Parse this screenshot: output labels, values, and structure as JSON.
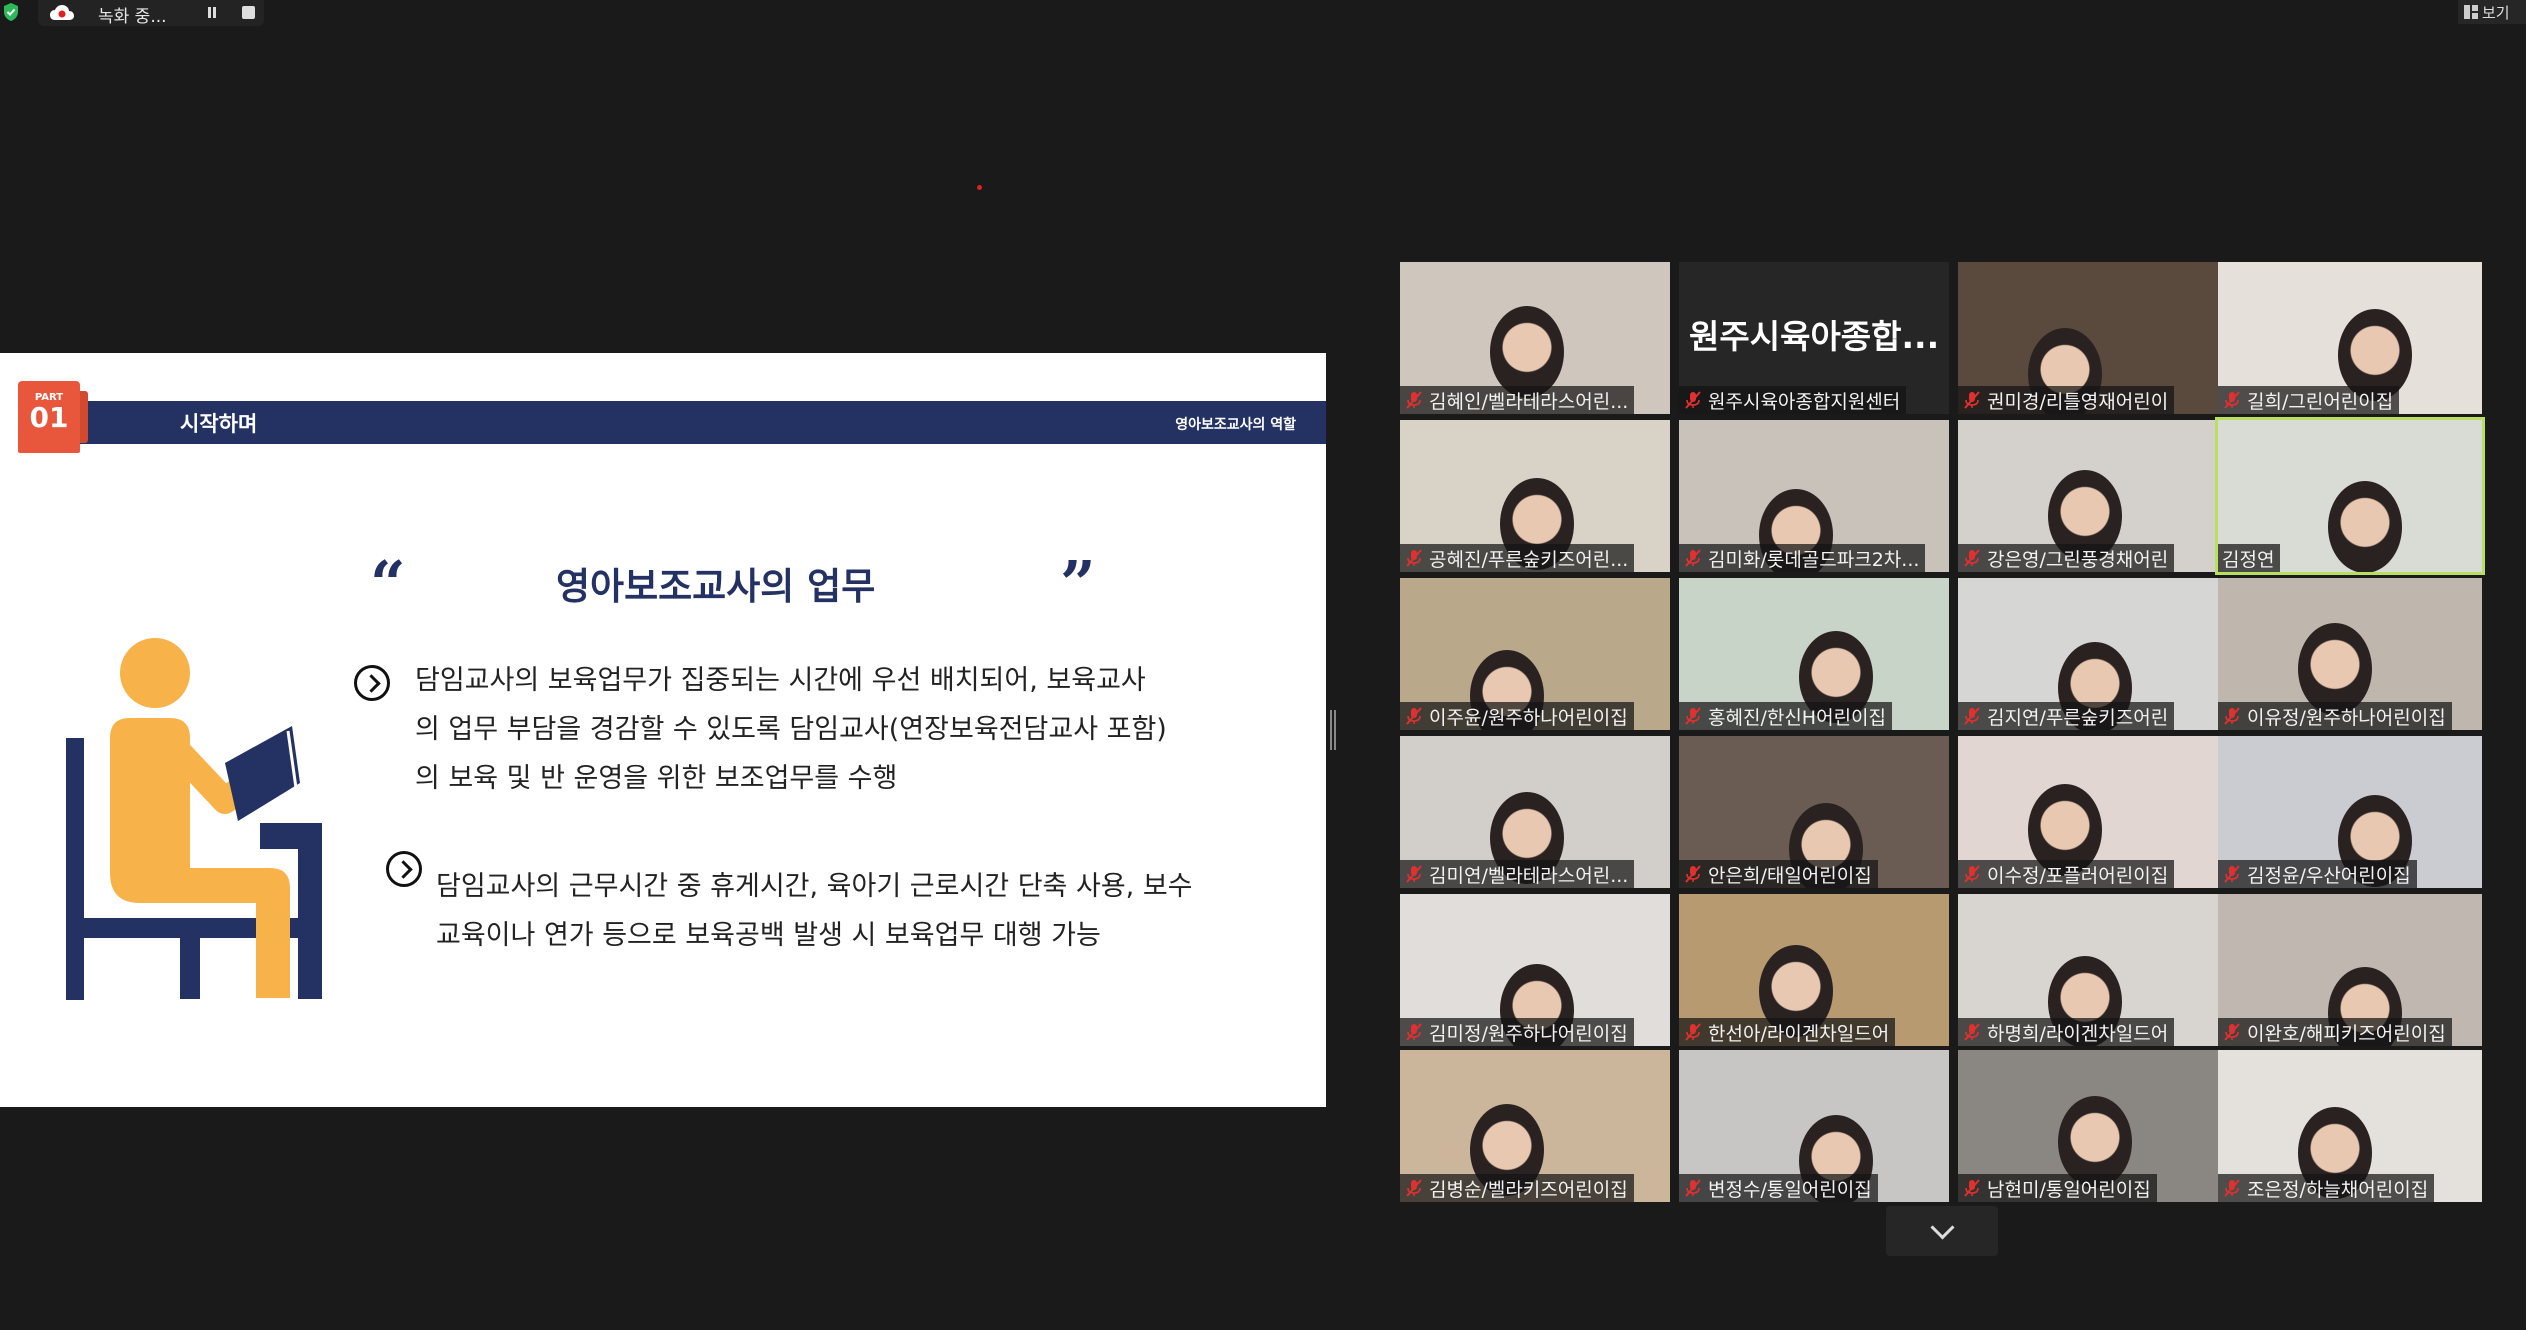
{
  "recording": {
    "status": "녹화 중..."
  },
  "view": {
    "label": "보기"
  },
  "slide": {
    "part_label": "PART",
    "part_number": "01",
    "section_title": "시작하며",
    "section_subtitle": "영아보조교사의 역할",
    "heading": "영아보조교사의 업무",
    "quote_open": "“",
    "quote_close": "”",
    "bullet1_lines": [
      "담임교사의 보육업무가 집중되는 시간에 우선 배치되어, 보육교사",
      "의 업무 부담을 경감할 수 있도록 담임교사(연장보육전담교사 포함)",
      "의 보육 및 반 운영을 위한 보조업무를 수행"
    ],
    "bullet2_lines": [
      "담임교사의 근무시간 중 휴게시간, 육아기 근로시간 단축 사용, 보수",
      "교육이나 연가 등으로 보육공백 발생 시 보육업무 대행 가능"
    ]
  },
  "participants": [
    {
      "name": "김혜인/벨라테라스어린...",
      "muted": true,
      "bg": "#cfc7bd"
    },
    {
      "name": "원주시육아종합지원센터",
      "muted": true,
      "bg": "#262626",
      "display": "원주시육아종합..."
    },
    {
      "name": "권미경/리틀영재어린이",
      "muted": true,
      "bg": "#5a4a3e"
    },
    {
      "name": "길희/그린어린이집",
      "muted": true,
      "bg": "#e6e0da"
    },
    {
      "name": "공혜진/푸른숲키즈어린...",
      "muted": true,
      "bg": "#d9d2c6"
    },
    {
      "name": "김미화/롯데골드파크2차...",
      "muted": true,
      "bg": "#c9c2bb"
    },
    {
      "name": "강은영/그린풍경채어린",
      "muted": true,
      "bg": "#d4d0cc"
    },
    {
      "name": "김정연",
      "muted": false,
      "bg": "#d8dcd4",
      "active": true
    },
    {
      "name": "이주윤/원주하나어린이집",
      "muted": true,
      "bg": "#b9a88a"
    },
    {
      "name": "홍혜진/한신H어린이집",
      "muted": true,
      "bg": "#c8d4c8"
    },
    {
      "name": "김지연/푸른숲키즈어린",
      "muted": true,
      "bg": "#d6d6d4"
    },
    {
      "name": "이유정/원주하나어린이집",
      "muted": true,
      "bg": "#bfb6ae"
    },
    {
      "name": "김미연/벨라테라스어린...",
      "muted": true,
      "bg": "#d2cfcb"
    },
    {
      "name": "안은희/태일어린이집",
      "muted": true,
      "bg": "#6a5c52"
    },
    {
      "name": "이수정/포플러어린이집",
      "muted": true,
      "bg": "#e2d6d2"
    },
    {
      "name": "김정윤/우산어린이집",
      "muted": true,
      "bg": "#cbcbd2"
    },
    {
      "name": "김미정/원주하나어린이집",
      "muted": true,
      "bg": "#e0ddda"
    },
    {
      "name": "한선아/라이겐차일드어",
      "muted": true,
      "bg": "#b89a70"
    },
    {
      "name": "하명희/라이겐차일드어",
      "muted": true,
      "bg": "#d8d4d0"
    },
    {
      "name": "이완호/해피키즈어린이집",
      "muted": true,
      "bg": "#c0b8b0"
    },
    {
      "name": "김병순/벨라키즈어린이집",
      "muted": true,
      "bg": "#cbb69c"
    },
    {
      "name": "변정수/통일어린이집",
      "muted": true,
      "bg": "#c8c6c4"
    },
    {
      "name": "남현미/통일어린이집",
      "muted": true,
      "bg": "#8a8682"
    },
    {
      "name": "조은정/하늘채어린이집",
      "muted": true,
      "bg": "#e4e0dc"
    }
  ],
  "colors": {
    "slide_navy": "#243163",
    "badge_red": "#e8573c",
    "figure_orange": "#f7b24a",
    "active_speaker": "#b8e060",
    "mute_red": "#e03030"
  }
}
